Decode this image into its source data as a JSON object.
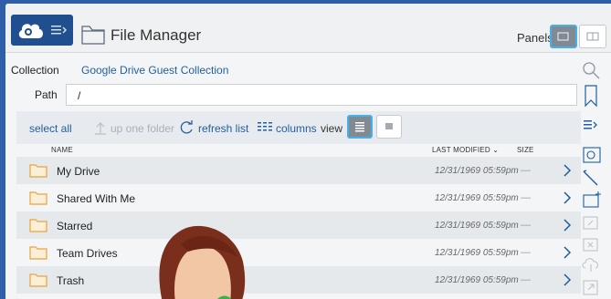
{
  "header": {
    "title": "File Manager",
    "panels_label": "Panels"
  },
  "collection": {
    "label": "Collection",
    "value": "Google Drive Guest Collection"
  },
  "path": {
    "label": "Path",
    "value": "/"
  },
  "toolbar": {
    "select_all": "select all",
    "up_one_folder": "up one folder",
    "refresh_list": "refresh list",
    "columns": "columns",
    "view": "view"
  },
  "table": {
    "headers": {
      "name": "NAME",
      "last_modified": "LAST MODIFIED ⌄",
      "size": "SIZE"
    },
    "rows": [
      {
        "name": "My Drive",
        "modified": "12/31/1969 05:59pm",
        "size": "—"
      },
      {
        "name": "Shared With Me",
        "modified": "12/31/1969 05:59pm",
        "size": "—"
      },
      {
        "name": "Starred",
        "modified": "12/31/1969 05:59pm",
        "size": "—"
      },
      {
        "name": "Team Drives",
        "modified": "12/31/1969 05:59pm",
        "size": "—"
      },
      {
        "name": "Trash",
        "modified": "12/31/1969 05:59pm",
        "size": "—"
      }
    ]
  },
  "icons": [
    "cloud-logo-icon",
    "menu-icon",
    "folder-icon",
    "search-icon",
    "bookmark-icon",
    "chevron-right-icon",
    "share-icon",
    "edit-icon",
    "new-folder-icon",
    "rename-icon",
    "delete-icon",
    "upload-icon",
    "open-icon"
  ],
  "colors": {
    "background": "#2f5fa8",
    "brand": "#1f4f8e",
    "link": "#1f5f9e",
    "selected_accent": "#47b0e6",
    "folder": "#e8a33c"
  }
}
